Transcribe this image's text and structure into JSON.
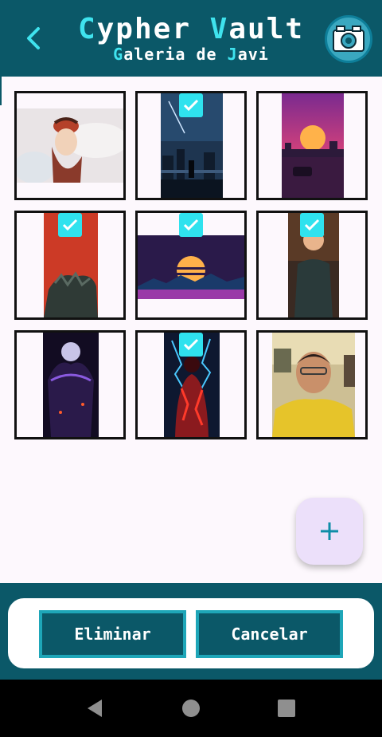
{
  "header": {
    "title_first": "C",
    "title_mid": "ypher ",
    "title_second": "V",
    "title_end": "ault",
    "subtitle_first": "G",
    "subtitle_mid": "aleria de ",
    "subtitle_second": "J",
    "subtitle_end": "avi",
    "background_color": "#0b5868",
    "accent_color": "#3fe3ee"
  },
  "gallery": {
    "images": [
      {
        "subject": "anime-girl-with-white-wolves",
        "selected": false
      },
      {
        "subject": "night-city-skyline-wallpaper",
        "selected": true
      },
      {
        "subject": "synthwave-sunset-city",
        "selected": false
      },
      {
        "subject": "red-monster-artwork",
        "selected": true
      },
      {
        "subject": "retro-synthwave-sun-landscape",
        "selected": true
      },
      {
        "subject": "anime-boy-in-hoodie",
        "selected": true
      },
      {
        "subject": "dark-purple-anime-character",
        "selected": false
      },
      {
        "subject": "red-lightning-character",
        "selected": true
      },
      {
        "subject": "selfie-yellow-hoodie",
        "selected": false
      }
    ],
    "check_color": "#2fe2ee"
  },
  "fab": {
    "icon": "plus-icon"
  },
  "actions": {
    "delete_label": "Eliminar",
    "cancel_label": "Cancelar"
  },
  "system_nav": {
    "icons": [
      "back-triangle-icon",
      "home-circle-icon",
      "recents-square-icon"
    ]
  }
}
